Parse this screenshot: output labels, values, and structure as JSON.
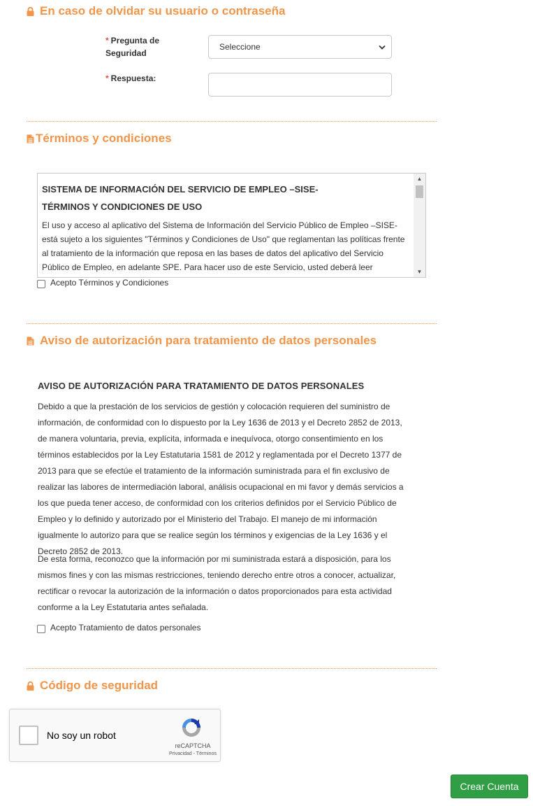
{
  "colors": {
    "accent": "#f0954a",
    "required": "#d9534f",
    "button": "#2f9e44"
  },
  "recovery": {
    "title": "En caso de olvidar su usuario o contraseña",
    "icon": "lock-icon",
    "question_label_line1": "Pregunta de",
    "question_label_line2": "Seguridad",
    "question_value": "Seleccione",
    "answer_label": "Respuesta:",
    "answer_value": "",
    "required_mark": "*"
  },
  "terms": {
    "title": "Términos y condiciones",
    "icon": "file-icon",
    "heading1": "SISTEMA DE INFORMACIÓN DEL SERVICIO DE EMPLEO –SISE-",
    "heading2": "TÉRMINOS Y CONDICIONES DE USO",
    "body": "El uso y acceso al aplicativo del Sistema de Información del Servicio Público de Empleo –SISE- está sujeto a los siguientes \"Términos y Condiciones de Uso\" que reglamentan las políticas frente al tratamiento de la información que reposa en las bases de datos del aplicativo del Servicio Público de Empleo, en adelante SPE. Para hacer uso de este Servicio, usted deberá leer",
    "accept_label": "Acepto Términos y Condiciones"
  },
  "privacy": {
    "title": "Aviso de autorización para tratamiento de datos personales",
    "icon": "file-icon",
    "heading": "AVISO DE AUTORIZACIÓN PARA TRATAMIENTO DE DATOS PERSONALES",
    "paragraph1": "Debido a que la prestación de los servicios de gestión y colocación requieren del suministro de información, de conformidad con lo dispuesto por la Ley 1636 de 2013 y el Decreto 2852 de 2013, de manera voluntaria, previa, explícita, informada e inequívoca, otorgo consentimiento en los términos establecidos por la Ley Estatutaria 1581 de 2012 y reglamentada por el Decreto 1377 de 2013 para que se efectúe el tratamiento de la información suministrada para el fin exclusivo de realizar las labores de intermediación laboral, análisis ocupacional en mi favor y demás servicios a los que pueda tener acceso, de conformidad con los criterios definidos por el Servicio Público de Empleo y lo definido y autorizado por el Ministerio del Trabajo. El manejo de mi información igualmente lo autorizo para que se realice según los términos y exigencias de la Ley 1636 y el Decreto 2852 de 2013.",
    "paragraph2": "De esta forma, reconozco que la información por mi suministrada estará a disposición, para los mismos fines y con las mismas restricciones, teniendo derecho entre otros a conocer, actualizar, rectificar o revocar la autorización de la información o datos proporcionados para esta actividad conforme a la Ley Estatutaria antes señalada.",
    "accept_label": "Acepto Tratamiento de datos personales"
  },
  "security": {
    "title": "Código de seguridad",
    "icon": "lock-icon",
    "captcha_label": "No soy un robot",
    "captcha_brand": "reCAPTCHA",
    "captcha_links": "Privacidad - Términos"
  },
  "actions": {
    "submit_label": "Crear Cuenta"
  }
}
